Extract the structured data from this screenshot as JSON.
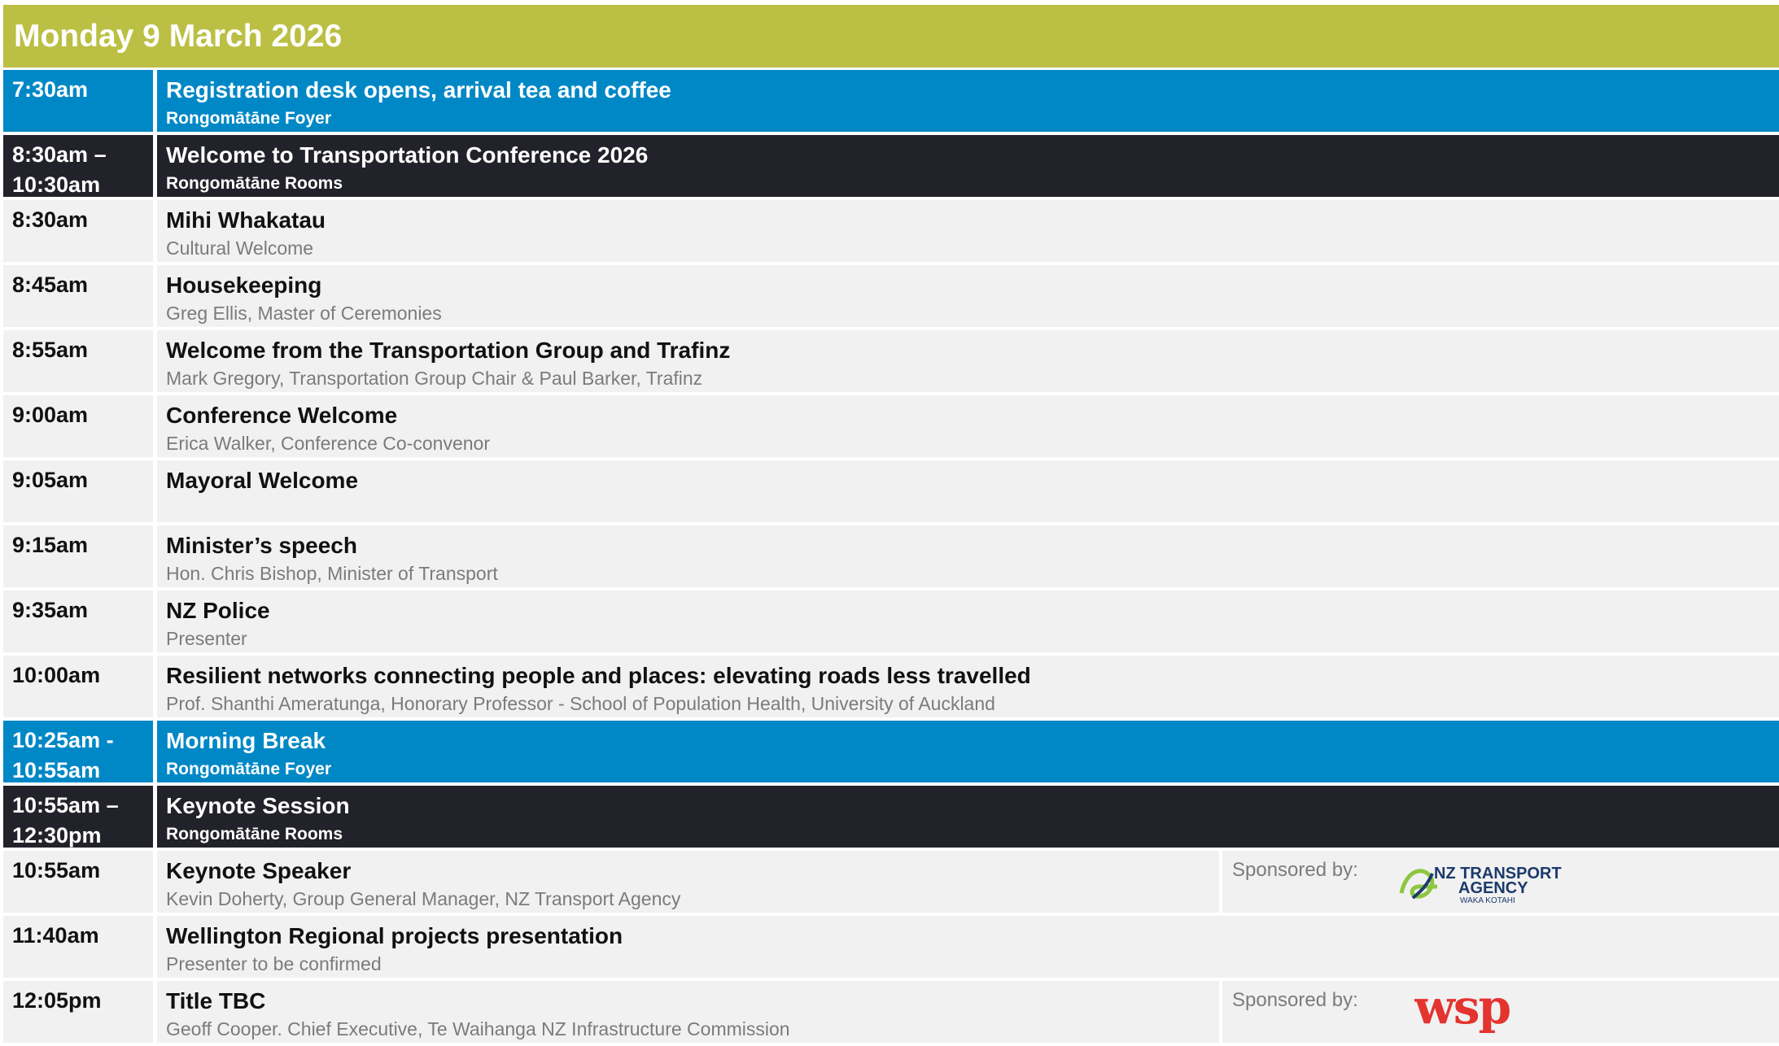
{
  "header": {
    "title": "Monday 9 March 2026"
  },
  "rows": [
    {
      "time": "7:30am",
      "title": "Registration desk opens, arrival tea and coffee",
      "sub": "Rongomātāne Foyer",
      "style": "blue"
    },
    {
      "time": "8:30am –\n10:30am",
      "title": "Welcome to Transportation Conference 2026",
      "sub": "Rongomātāne Rooms",
      "style": "dark"
    },
    {
      "time": "8:30am",
      "title": "Mihi Whakatau",
      "sub": "Cultural Welcome",
      "style": "plain"
    },
    {
      "time": "8:45am",
      "title": "Housekeeping",
      "sub": "Greg Ellis, Master of Ceremonies",
      "style": "plain"
    },
    {
      "time": "8:55am",
      "title": "Welcome from the Transportation Group and Trafinz",
      "sub": "Mark Gregory, Transportation Group Chair & Paul Barker, Trafinz",
      "style": "plain"
    },
    {
      "time": "9:00am",
      "title": "Conference Welcome",
      "sub": "Erica Walker, Conference Co-convenor",
      "style": "plain"
    },
    {
      "time": "9:05am",
      "title": "Mayoral Welcome",
      "sub": "",
      "style": "plain"
    },
    {
      "time": "9:15am",
      "title": "Minister’s speech",
      "sub": "Hon. Chris Bishop, Minister of Transport",
      "style": "plain"
    },
    {
      "time": "9:35am",
      "title": "NZ Police",
      "sub": "Presenter",
      "style": "plain"
    },
    {
      "time": "10:00am",
      "title": "Resilient networks connecting people and places: elevating roads less travelled",
      "sub": "Prof. Shanthi Ameratunga, Honorary Professor - School of Population Health, University of Auckland",
      "style": "plain"
    },
    {
      "time": "10:25am -\n10:55am",
      "title": "Morning Break",
      "sub": "Rongomātāne Foyer",
      "style": "blue"
    },
    {
      "time": "10:55am –\n12:30pm",
      "title": "Keynote Session",
      "sub": "Rongomātāne Rooms",
      "style": "dark"
    },
    {
      "time": "10:55am",
      "title": "Keynote Speaker",
      "sub": "Kevin Doherty, Group General Manager, NZ Transport Agency",
      "style": "plain",
      "sponsor": {
        "label": "Sponsored by:",
        "logo": "nzta-logo",
        "logo_text": [
          "NZ TRANSPORT",
          "AGENCY",
          "WAKA KOTAHI"
        ]
      }
    },
    {
      "time": "11:40am",
      "title": "Wellington Regional projects presentation",
      "sub": "Presenter to be confirmed",
      "style": "plain"
    },
    {
      "time": "12:05pm",
      "title": "Title TBC",
      "sub": "Geoff Cooper. Chief Executive, Te Waihanga NZ Infrastructure Commission",
      "style": "plain",
      "sponsor": {
        "label": "Sponsored by:",
        "logo": "wsp-logo",
        "logo_text": [
          "wsp"
        ]
      }
    }
  ],
  "colors": {
    "header": "#bbbf44",
    "blue": "#0088c6",
    "dark": "#22222a",
    "plain": "#f1f1f1",
    "wsp": "#e3342f",
    "nzta_green": "#8dc63f",
    "nzta_blue": "#1b3a6b"
  }
}
